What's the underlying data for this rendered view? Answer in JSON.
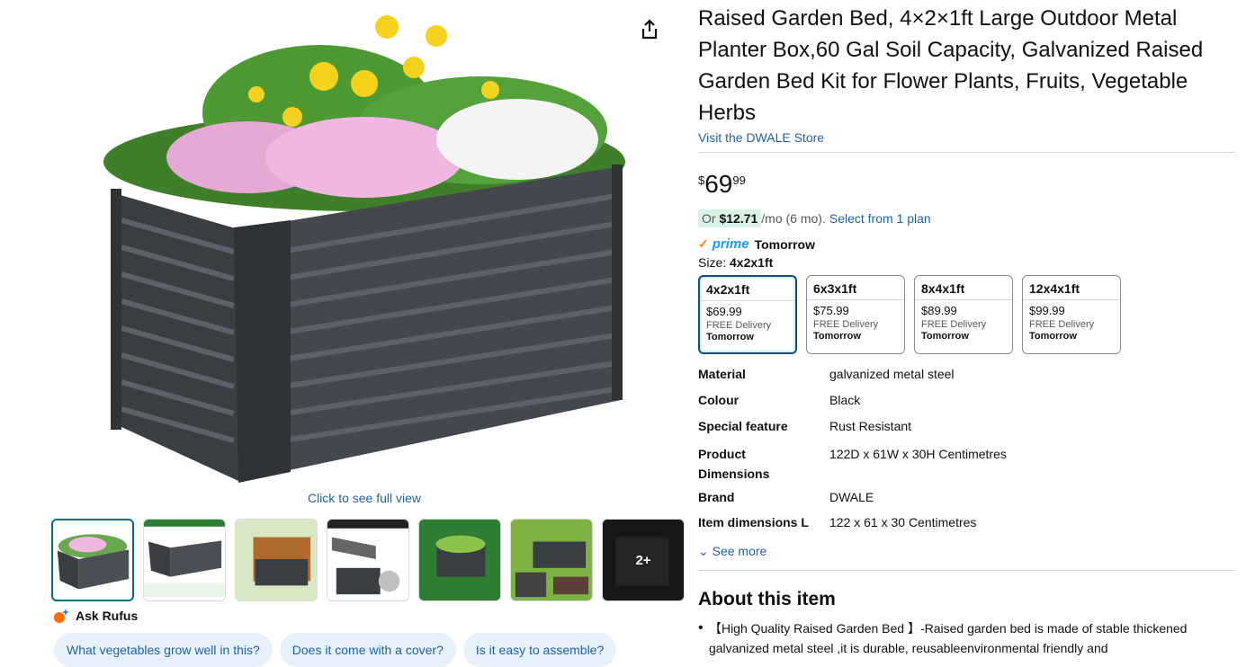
{
  "product": {
    "title": "Raised Garden Bed, 4×2×1ft Large Outdoor Metal Planter Box,60 Gal Soil Capacity, Galvanized Raised Garden Bed Kit for Flower Plants, Fruits, Vegetable Herbs",
    "store_link": "Visit the DWALE Store",
    "price_symbol": "$",
    "price_whole": "69",
    "price_fraction": "99",
    "installment_or": "Or ",
    "installment_amount": "$12.71",
    "installment_term": "/mo (6 mo).",
    "installment_link": "Select from 1 plan",
    "prime_check": "✓",
    "prime_logo": "prime",
    "prime_delivery": "Tomorrow",
    "size_label": "Size:",
    "size_selected": "4x2x1ft"
  },
  "sizes": [
    {
      "name": "4x2x1ft",
      "price": "$69.99",
      "delivery": "FREE Delivery",
      "day": "Tomorrow"
    },
    {
      "name": "6x3x1ft",
      "price": "$75.99",
      "delivery": "FREE Delivery",
      "day": "Tomorrow"
    },
    {
      "name": "8x4x1ft",
      "price": "$89.99",
      "delivery": "FREE Delivery",
      "day": "Tomorrow"
    },
    {
      "name": "12x4x1ft",
      "price": "$99.99",
      "delivery": "FREE Delivery",
      "day": "Tomorrow"
    }
  ],
  "specs": [
    {
      "key": "Material",
      "value": "galvanized metal steel"
    },
    {
      "key": "Colour",
      "value": "Black"
    },
    {
      "key": "Special feature",
      "value": "Rust Resistant"
    },
    {
      "key": "Product Dimensions",
      "value": "122D x 61W x 30H Centimetres"
    },
    {
      "key": "Brand",
      "value": "DWALE"
    },
    {
      "key": "Item dimensions L",
      "value": "122 x 61 x 30 Centimetres"
    }
  ],
  "see_more": "See more",
  "about_heading": "About this item",
  "about_bullets": [
    "【High Quality Raised Garden Bed 】-Raised garden bed is made of stable thickened galvanized metal steel ,it is durable, reusableenvironmental friendly and"
  ],
  "gallery": {
    "full_view": "Click to see full view",
    "more_count": "2+"
  },
  "rufus": {
    "label": "Ask Rufus",
    "chips": [
      "What vegetables grow well in this?",
      "Does it come with a cover?",
      "Is it easy to assemble?"
    ]
  }
}
